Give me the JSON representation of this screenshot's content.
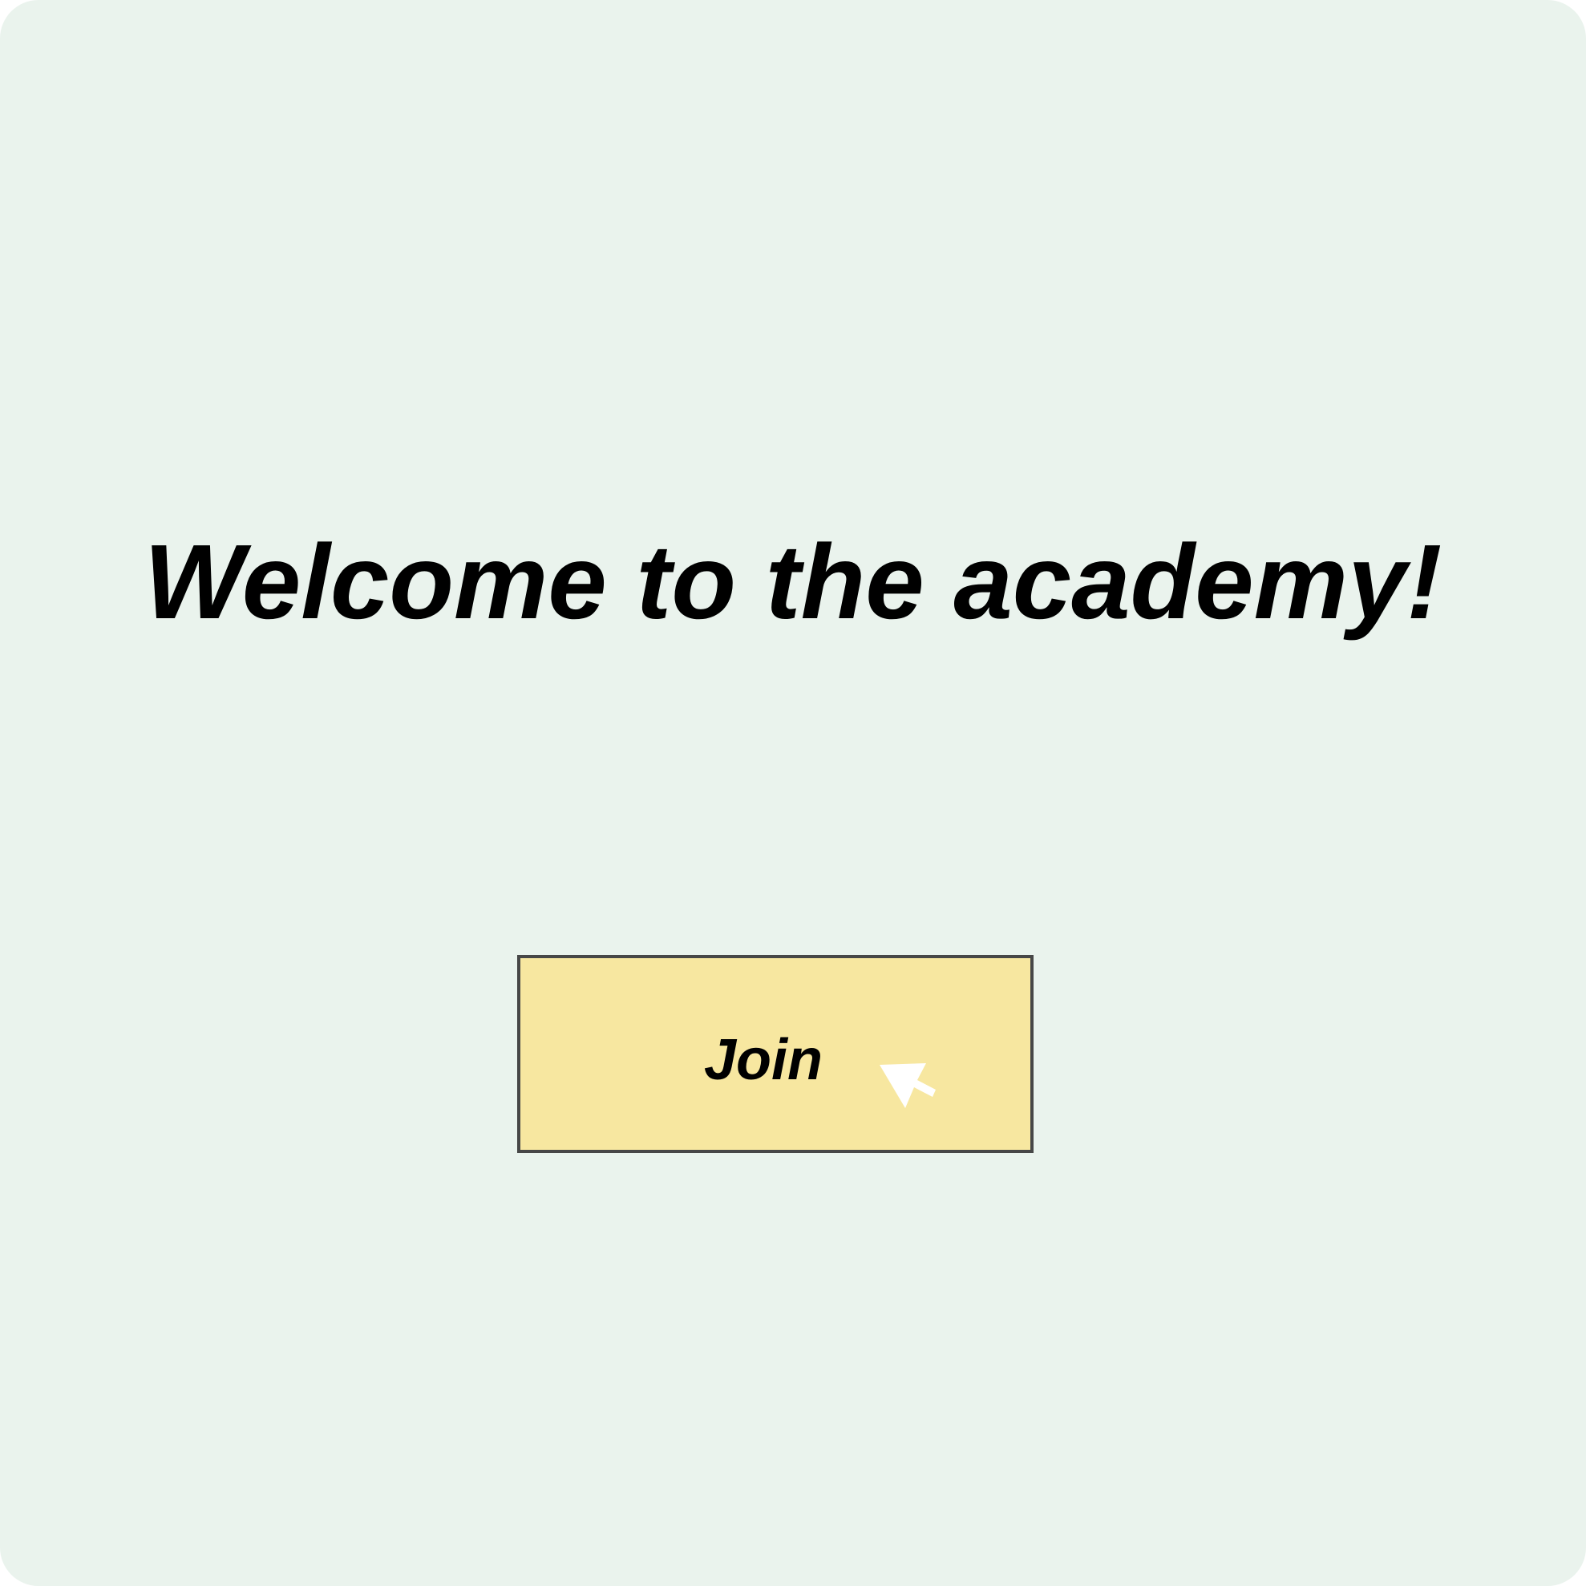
{
  "page": {
    "title": "Welcome to the academy!"
  },
  "join_button": {
    "label": "Join"
  },
  "cursor": {
    "icon": "mouse-pointer-icon"
  },
  "colors": {
    "background": "#eaf3ed",
    "button_fill": "#f7e7a0",
    "button_border": "#474747",
    "text": "#000000",
    "cursor": "#ffffff"
  }
}
